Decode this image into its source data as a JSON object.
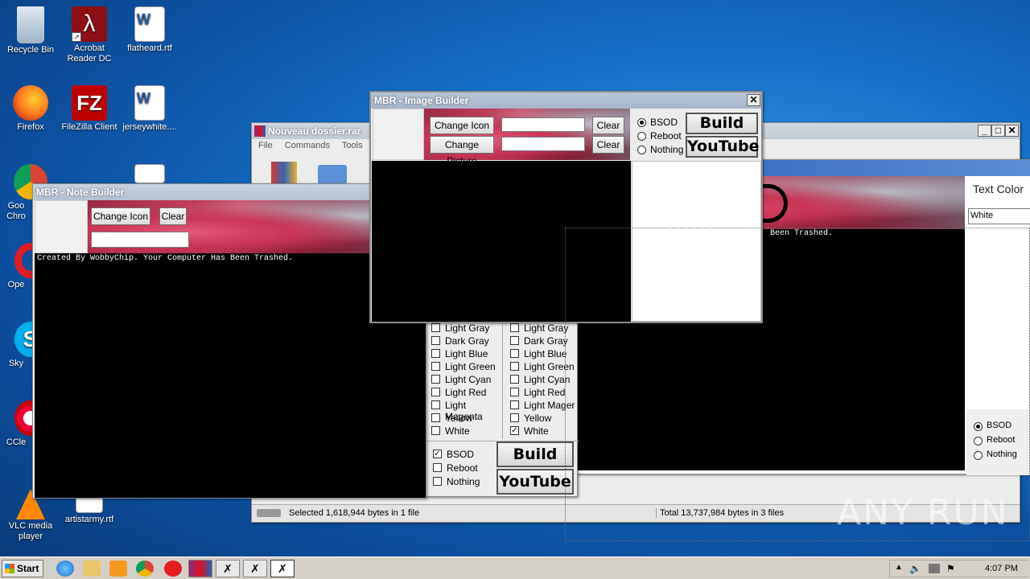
{
  "desktop": {
    "icons": [
      {
        "label": "Recycle Bin",
        "icon": "recycle-bin-icon"
      },
      {
        "label": "Acrobat Reader DC",
        "icon": "acrobat-icon"
      },
      {
        "label": "flatheard.rtf",
        "icon": "word-doc-icon"
      },
      {
        "label": "Firefox",
        "icon": "firefox-icon"
      },
      {
        "label": "FileZilla Client",
        "icon": "filezilla-icon"
      },
      {
        "label": "jerseywhite....",
        "icon": "word-doc-icon"
      },
      {
        "label": "Goo Chro",
        "icon": "chrome-icon"
      },
      {
        "label": "Ope",
        "icon": "opera-icon"
      },
      {
        "label": "Sky",
        "icon": "skype-icon"
      },
      {
        "label": "CCle",
        "icon": "ccleaner-icon"
      },
      {
        "label": "VLC media player",
        "icon": "vlc-icon"
      },
      {
        "label": "artistarmy.rtf",
        "icon": "doc-icon"
      }
    ]
  },
  "winrar": {
    "title": "Nouveau dossier.rar",
    "menu": [
      "File",
      "Commands",
      "Tools",
      "Fa"
    ],
    "status_left": "Selected 1,618,944 bytes in 1 file",
    "status_right": "Total 13,737,984 bytes in 3 files"
  },
  "note_builder": {
    "title": "MBR - Note Builder",
    "change_icon": "Change Icon",
    "clear": "Clear",
    "note_text": "Created By WobbyChip. Your Computer Has Been Trashed."
  },
  "image_builder": {
    "title": "MBR - Image Builder",
    "change_icon": "Change Icon",
    "change_picture": "Change Picture",
    "clear1": "Clear",
    "clear2": "Clear",
    "options": [
      "BSOD",
      "Reboot",
      "Nothing"
    ],
    "build": "Build",
    "youtube": "YouTube"
  },
  "color_panel": {
    "col1": [
      "Light Gray",
      "Dark Gray",
      "Light Blue",
      "Light Green",
      "Light Cyan",
      "Light Red",
      "Light Magenta",
      "Yellow",
      "White"
    ],
    "col2": [
      "Light Gray",
      "Dark Gray",
      "Light Blue",
      "Light Green",
      "Light Cyan",
      "Light Red",
      "Light Mager",
      "Yellow",
      "White"
    ],
    "actions": [
      "BSOD",
      "Reboot",
      "Nothing"
    ],
    "build": "Build",
    "youtube": "YouTube"
  },
  "text_builder": {
    "text_color_label": "Text Color",
    "text_color_value": "White",
    "trashed_text": "Been Trashed.",
    "options": [
      "BSOD",
      "Reboot",
      "Nothing"
    ]
  },
  "taskbar": {
    "start": "Start",
    "time": "4:07 PM"
  },
  "watermark": "ANY RUN"
}
